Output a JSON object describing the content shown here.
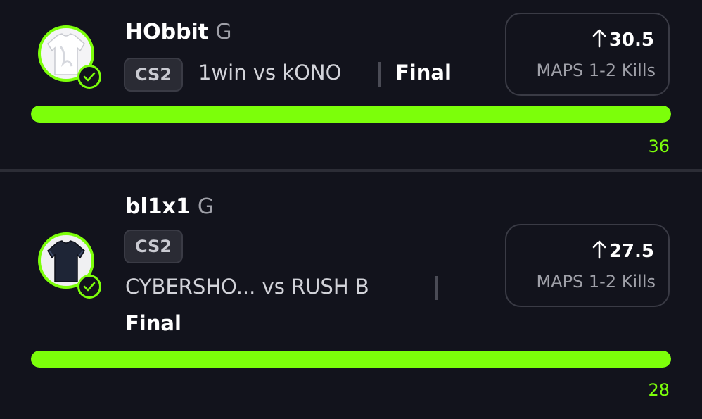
{
  "accent_color": "#7cff0a",
  "picks": [
    {
      "player": "HObbit",
      "position": "G",
      "game": "CS2",
      "matchup": "1win vs kONO",
      "status": "Final",
      "direction_icon": "arrow-up-icon",
      "line": "30.5",
      "stat": "MAPS 1-2 Kills",
      "result": "36",
      "progress": 1.0,
      "jersey_icon": "white-jersey-icon"
    },
    {
      "player": "bl1x1",
      "position": "G",
      "game": "CS2",
      "matchup": "CYBERSHO... vs RUSH B",
      "status": "Final",
      "direction_icon": "arrow-up-icon",
      "line": "27.5",
      "stat": "MAPS 1-2 Kills",
      "result": "28",
      "progress": 1.0,
      "jersey_icon": "dark-jersey-icon"
    }
  ]
}
